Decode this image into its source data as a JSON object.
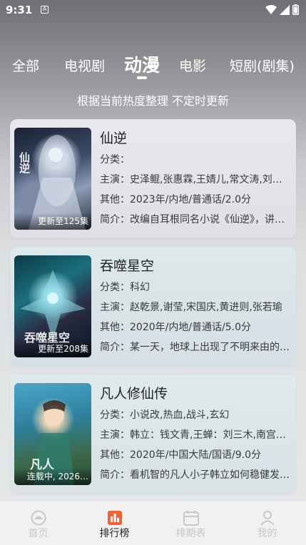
{
  "status_bar": {
    "time": "9:31",
    "notification_glyph": "A"
  },
  "tabs": [
    {
      "label": "全部"
    },
    {
      "label": "电视剧"
    },
    {
      "label": "动漫",
      "active": true
    },
    {
      "label": "电影"
    },
    {
      "label": "短剧(剧集)"
    }
  ],
  "subtitle": "根据当前热度整理 不定时更新",
  "cards": [
    {
      "title": "仙逆",
      "badge": "更新至125集",
      "genre": "分类：",
      "cast": "主演：史泽鲲,张惠霖,王婧儿,常文涛,刘…",
      "other": "其他：2023年/内地/普通话/2.0分",
      "summary": "简介：改编自耳根同名小说《仙逆》，讲…",
      "poster_text": "仙逆"
    },
    {
      "title": "吞噬星空",
      "badge": "更新至208集",
      "genre": "分类：科幻",
      "cast": "主演：赵乾景,谢莹,宋国庆,黄进则,张若瑜",
      "other": "其他：2020年/内地/普通话/5.0分",
      "summary": "简介：某一天，地球上出现了不明来由的…",
      "poster_text": "吞噬星空"
    },
    {
      "title": "凡人修仙传",
      "badge": "连载中, 2026…",
      "genre": "分类：小说改,热血,战斗,玄幻",
      "cast": "主演：韩立：钱文青,王蝉：刘三木,南宫…",
      "other": "其他：2020年/中国大陆/国语/9.0分",
      "summary": "简介：看机智的凡人小子韩立如何稳健发…",
      "poster_text": "凡人"
    }
  ],
  "bottom_nav": [
    {
      "label": "首页",
      "icon": "home-icon"
    },
    {
      "label": "排行榜",
      "icon": "ranking-icon",
      "active": true
    },
    {
      "label": "排期表",
      "icon": "calendar-icon"
    },
    {
      "label": "我的",
      "icon": "profile-icon"
    }
  ],
  "colors": {
    "accent": "#f0623a",
    "inactive_nav": "#c8c8ca"
  }
}
